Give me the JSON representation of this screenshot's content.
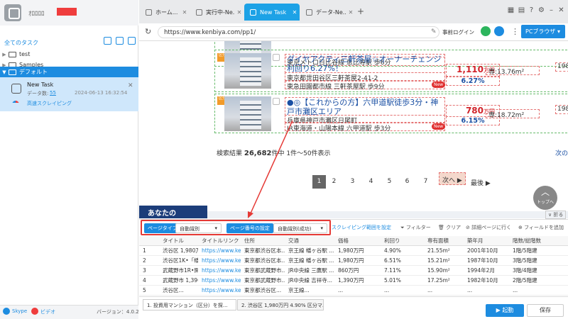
{
  "sidebar": {
    "username": "ｵﾛﾛﾛﾛ",
    "tasks_title": "全てのタスク",
    "tree": [
      {
        "label": "test"
      },
      {
        "label": "Samples"
      },
      {
        "label": "デフォルト"
      }
    ],
    "task": {
      "name": "New Task",
      "count_label": "データ数:",
      "count": "55",
      "date": "2024-06-13 16:32:54",
      "link": "高速スクレイピング"
    },
    "footer": {
      "skype": "Skype",
      "video": "ビデオ",
      "version": "バージョン：4.0.2"
    }
  },
  "tabs": [
    {
      "label": "ホーム..."
    },
    {
      "label": "実行中-Ne..."
    },
    {
      "label": "New Task"
    },
    {
      "label": "データ-Ne..."
    }
  ],
  "urlbar": {
    "url": "https://www.kenbiya.com/pp1/",
    "pre_login": "事前ログイン",
    "mode": "PCブラウザ"
  },
  "web": {
    "listing_top_station": "東京メトロ日比谷線 恵比寿駅 歩6分",
    "listing1": {
      "tag": "区分",
      "title": "ダイヤアクティ三軒茶屋☆オーナーチェンジ利回り6.27%！",
      "address": "東京都世田谷区三軒茶屋2-41-2",
      "station": "東急田園都市線 三軒茶屋駅 歩9分",
      "new": "New",
      "price": "1,110",
      "price_unit": "万円",
      "yield": "6.27",
      "yield_unit": "%",
      "area": "専:13.76m²",
      "year": "198"
    },
    "listing2": {
      "tag": "区分",
      "title": "●◎【これからの方】六甲道駅徒歩3分・神戸市灘区エリア",
      "address": "兵庫県神戸市灘区日尾町",
      "station": "JR東海道・山陽本線 六甲道駅 歩3分",
      "new": "New",
      "price": "780",
      "price_unit": "万円",
      "yield": "6.15",
      "yield_unit": "%",
      "area": "専:18.72m²",
      "year": "198"
    },
    "results_label": "検索結果",
    "results_count": "26,682",
    "results_unit": "件中",
    "results_range": "1件～50件表示",
    "next_short": "次の",
    "pages": [
      "1",
      "2",
      "3",
      "4",
      "5",
      "6",
      "7"
    ],
    "next": "次へ ▶",
    "last": "最後 ▶",
    "banner": "あなたの",
    "to_top": "トップへ",
    "fold": "折る"
  },
  "toolbar": {
    "page_type_label": "ページタイプ",
    "page_type_value": "自動識別",
    "page_num_label": "ページ番号の設定",
    "page_num_value": "自動識別(成功)",
    "scroll_range": "スクレイピング範囲を設定",
    "filter": "フィルター",
    "clear": "クリア",
    "detail": "詳細ページに行く",
    "add_field": "フィールドを追加"
  },
  "table": {
    "headers": [
      "タイトル",
      "タイトルリンク",
      "住所",
      "交通",
      "価格",
      "利回り",
      "専有面積",
      "築年月",
      "階数/総階数"
    ],
    "rows": [
      [
        "1",
        "渋谷区 1,980万...",
        "https://www.kenb...",
        "東京都渋谷区本...",
        "京王線 幡ヶ谷駅 ...",
        "1,980万円",
        "4.90%",
        "21.55m²",
        "2001年10月",
        "1階/5階建"
      ],
      [
        "2",
        "渋谷区1K•「幡...",
        "https://www.kenb...",
        "東京都渋谷区本...",
        "京王線 幡ヶ谷駅 ...",
        "1,980万円",
        "6.51%",
        "15.21m²",
        "1987年10月",
        "3階/5階建"
      ],
      [
        "3",
        "武蔵野市1R•閑...",
        "https://www.kenb...",
        "東京都武蔵野市...",
        "JR中央線 三鷹駅 ...",
        "860万円",
        "7.11%",
        "15.90m²",
        "1994年2月",
        "3階/4階建"
      ],
      [
        "4",
        "武蔵野市 1,390...",
        "https://www.kenb...",
        "東京都武蔵野市...",
        "JR中央線 吉祥寺...",
        "1,390万円",
        "5.01%",
        "17.25m²",
        "1982年10月",
        "2階/5階建"
      ],
      [
        "5",
        "渋谷区...",
        "https://www.kenb...",
        "東京都渋谷区...",
        "京王線...",
        "...",
        "...",
        "...",
        "...",
        "..."
      ]
    ]
  },
  "bottom": {
    "tab1": "1. 投資用マンション（区分）を探...",
    "tab2": "2. 渋谷区 1,980万円 4.90% 区分マ...",
    "start": "▶ 起動",
    "save": "保存"
  }
}
